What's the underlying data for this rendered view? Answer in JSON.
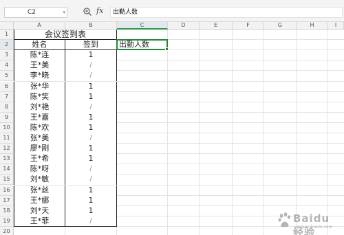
{
  "formula_bar": {
    "cell_ref": "C2",
    "fx_label": "fx",
    "formula": "出勤人数"
  },
  "columns": [
    "A",
    "B",
    "C",
    "D",
    "E",
    "F",
    "G",
    "H",
    "I"
  ],
  "rows": [
    "1",
    "2",
    "3",
    "4",
    "5",
    "6",
    "7",
    "8",
    "9",
    "10",
    "11",
    "12",
    "13",
    "14",
    "15",
    "16",
    "17",
    "18",
    "19",
    "20"
  ],
  "sheet": {
    "title": "会议签到表",
    "headers": {
      "name": "姓名",
      "signin": "签到",
      "attendance": "出勤人数"
    },
    "records": [
      {
        "name": "陈*连",
        "signin": "1"
      },
      {
        "name": "王*美",
        "signin": "/"
      },
      {
        "name": "李*晓",
        "signin": "/"
      },
      {
        "name": "张*华",
        "signin": "1"
      },
      {
        "name": "陈*笑",
        "signin": "1"
      },
      {
        "name": "刘*艳",
        "signin": "/"
      },
      {
        "name": "王*嘉",
        "signin": "1"
      },
      {
        "name": "陈*欢",
        "signin": "1"
      },
      {
        "name": "张*美",
        "signin": "/"
      },
      {
        "name": "廖*刚",
        "signin": "1"
      },
      {
        "name": "王*希",
        "signin": "1"
      },
      {
        "name": "陈*呀",
        "signin": "/"
      },
      {
        "name": "刘*敏",
        "signin": "/"
      },
      {
        "name": "张*丝",
        "signin": "1"
      },
      {
        "name": "王*娜",
        "signin": "1"
      },
      {
        "name": "刘*天",
        "signin": "1"
      },
      {
        "name": "王*菲",
        "signin": "/"
      }
    ]
  },
  "watermark": {
    "text": "Baidu经验",
    "sub": "jingyan.baidu.com"
  }
}
